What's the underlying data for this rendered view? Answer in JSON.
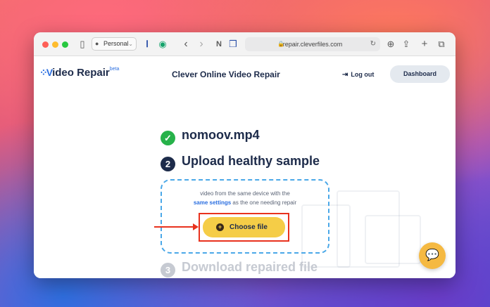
{
  "browser": {
    "profile_label": "Personal",
    "url": "repair.clevefiles.com_placeholder"
  },
  "site": {
    "logo_text": "ideo Repair",
    "logo_badge": "beta",
    "title": "Clever Online Video Repair",
    "logout_label": "Log out",
    "dashboard_label": "Dashboard"
  },
  "steps": {
    "step1_number": "✓",
    "step1_label": "nomoov.mp4",
    "step2_number": "2",
    "step2_label": "Upload healthy sample",
    "step3_number": "3",
    "step3_label": "Download repaired file"
  },
  "upload": {
    "hint_line1": "video from the same device with the",
    "hint_emphasis": "same settings",
    "hint_line2_rest": " as the one needing repair",
    "button_label": "Choose file"
  },
  "colors": {
    "accent": "#2b6fe0",
    "success": "#27b24a",
    "button": "#f5cd47",
    "annotation": "#e8321e"
  },
  "icons": [
    "sidebar-icon",
    "person-icon",
    "reader-icon",
    "grammarly-icon",
    "back-icon",
    "forward-icon",
    "notion-icon",
    "lock-icon",
    "reload-icon",
    "download-icon",
    "share-icon",
    "plus-icon",
    "tabs-icon",
    "logout-icon",
    "chat-icon"
  ]
}
